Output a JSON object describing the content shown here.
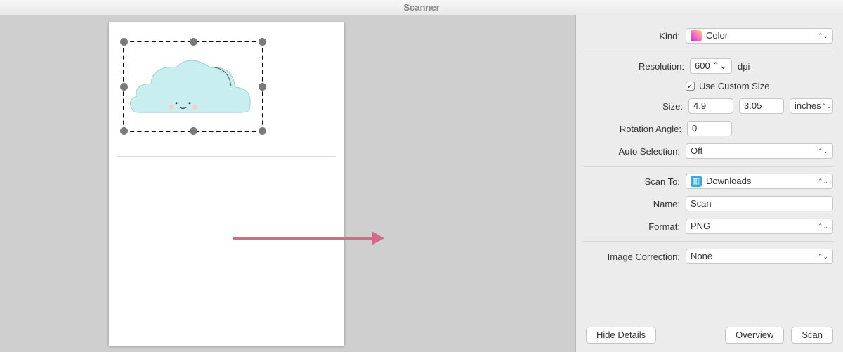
{
  "title": "Scanner",
  "labels": {
    "kind": "Kind:",
    "resolution": "Resolution:",
    "useCustom": "Use Custom Size",
    "size": "Size:",
    "rotation": "Rotation Angle:",
    "autosel": "Auto Selection:",
    "scanto": "Scan To:",
    "name": "Name:",
    "format": "Format:",
    "imgcorr": "Image Correction:"
  },
  "values": {
    "kind": "Color",
    "resolution": "600",
    "dpi": "dpi",
    "width": "4.9",
    "height": "3.05",
    "sizeunit": "inches",
    "rotation": "0",
    "autosel": "Off",
    "scanto": "Downloads",
    "name": "Scan",
    "format": "PNG",
    "imgcorr": "None"
  },
  "buttons": {
    "hideDetails": "Hide Details",
    "overview": "Overview",
    "scan": "Scan"
  },
  "glyphs": {
    "caret": "⌃⌄",
    "check": "✓"
  }
}
